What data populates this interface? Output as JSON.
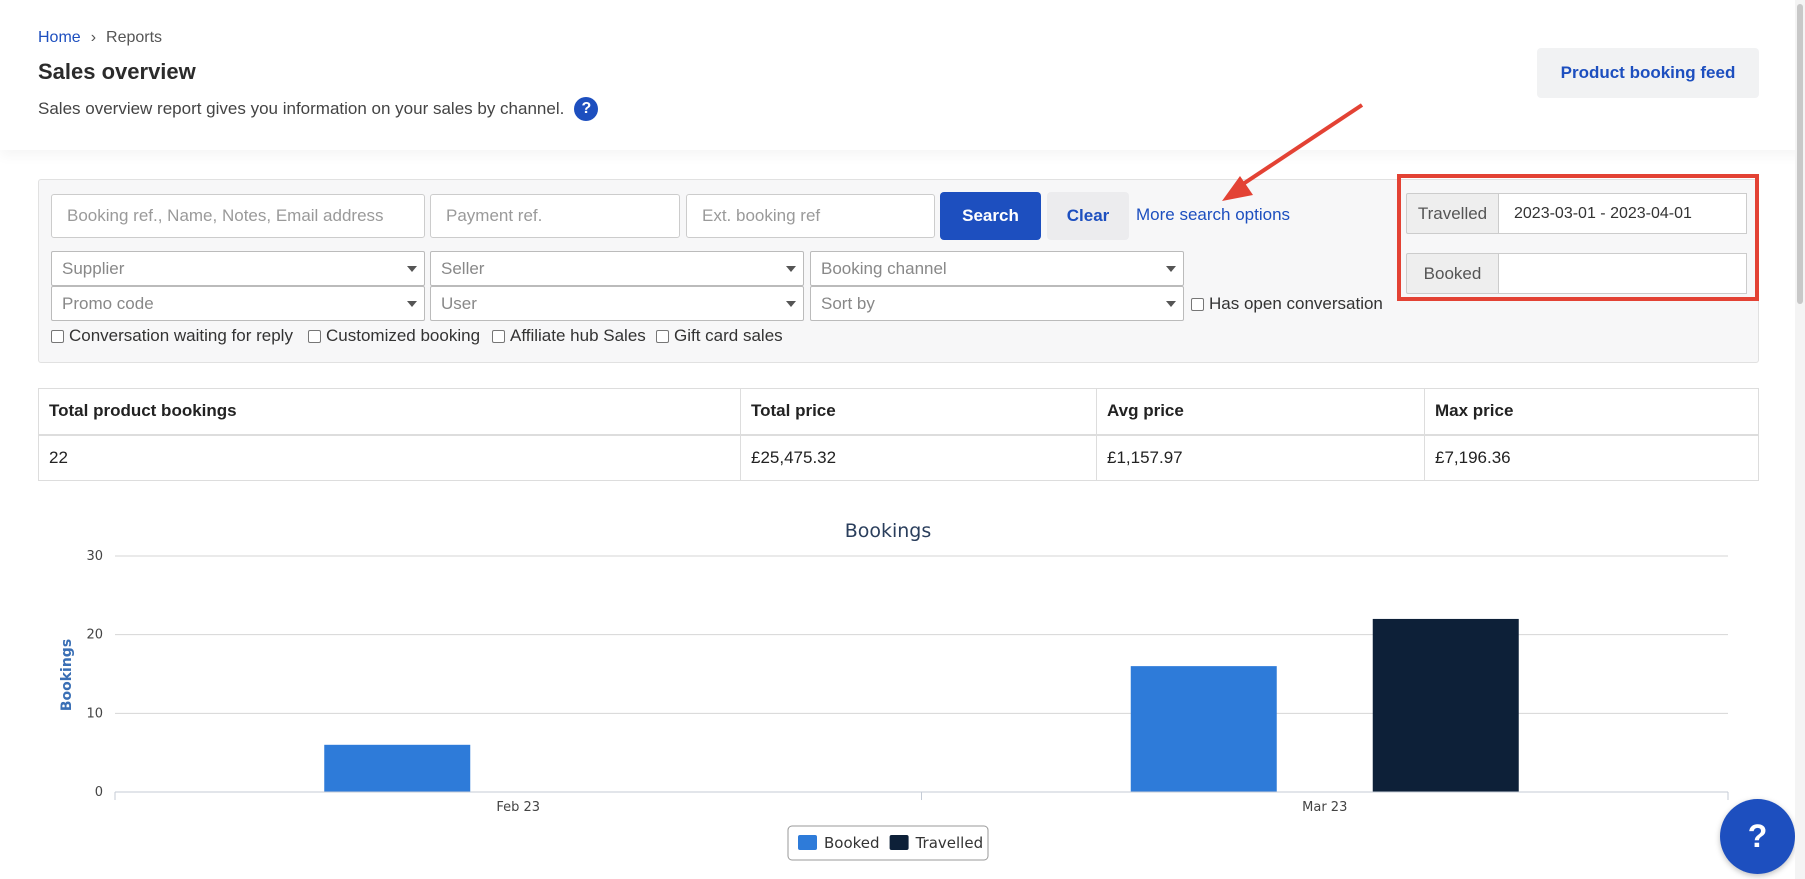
{
  "breadcrumb": {
    "home": "Home",
    "separator": "›",
    "current": "Reports"
  },
  "header": {
    "title": "Sales overview",
    "description": "Sales overview report gives you information on your sales by channel.",
    "help_glyph": "?",
    "feed_button": "Product booking feed"
  },
  "filters": {
    "search_placeholder": "Booking ref., Name, Notes, Email address",
    "payment_placeholder": "Payment ref.",
    "ext_placeholder": "Ext. booking ref",
    "search_button": "Search",
    "clear_button": "Clear",
    "more_options": "More search options",
    "selects": {
      "supplier": "Supplier",
      "seller": "Seller",
      "booking_channel": "Booking channel",
      "promo_code": "Promo code",
      "user": "User",
      "sort_by": "Sort by"
    },
    "checkboxes": {
      "open_conversation": "Has open conversation",
      "waiting_reply": "Conversation waiting for reply",
      "customized": "Customized booking",
      "affiliate": "Affiliate hub Sales",
      "gift_card": "Gift card sales"
    },
    "dates": {
      "travelled_label": "Travelled",
      "travelled_value": "2023-03-01 - 2023-04-01",
      "booked_label": "Booked",
      "booked_value": ""
    }
  },
  "summary": {
    "headers": [
      "Total product bookings",
      "Total price",
      "Avg price",
      "Max price"
    ],
    "values": [
      "22",
      "£25,475.32",
      "£1,157.97",
      "£7,196.36"
    ]
  },
  "chart_data": {
    "type": "bar",
    "title": "Bookings",
    "ylabel": "Bookings",
    "xlabel": "",
    "categories": [
      "Feb 23",
      "Mar 23"
    ],
    "series": [
      {
        "name": "Booked",
        "values": [
          6,
          16
        ],
        "color": "#2e7bd9"
      },
      {
        "name": "Travelled",
        "values": [
          0,
          22
        ],
        "color": "#0d2038"
      }
    ],
    "ylim": [
      0,
      30
    ],
    "yticks": [
      0,
      10,
      20,
      30
    ],
    "grid": true,
    "legend": "bottom-center"
  },
  "fab_glyph": "?",
  "colors": {
    "accent": "#1d4fbf",
    "highlight": "#e34234"
  }
}
